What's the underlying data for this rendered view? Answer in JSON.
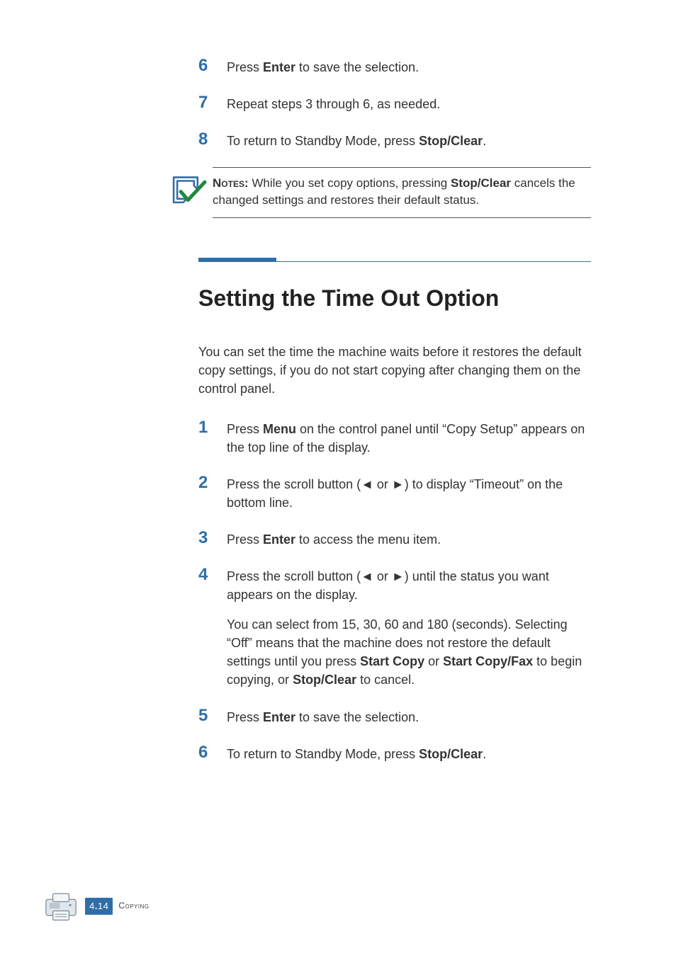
{
  "steps_top": [
    {
      "num": "6",
      "html": "Press <b>Enter</b> to save the selection."
    },
    {
      "num": "7",
      "html": "Repeat steps 3 through 6, as needed."
    },
    {
      "num": "8",
      "html": "To return to Standby Mode, press <b>Stop/Clear</b>."
    }
  ],
  "note": {
    "label": "Notes:",
    "text": " While you set copy options, pressing <b>Stop/Clear</b> cancels the changed settings and restores their default status."
  },
  "section": {
    "title": "Setting the Time Out Option",
    "intro": "You can set the time the machine waits before it restores the default copy settings, if you do not start copying after changing them on the control panel."
  },
  "steps_bottom": [
    {
      "num": "1",
      "html": "Press <b>Menu</b> on the control panel until “Copy Setup” appears on the top line of the display."
    },
    {
      "num": "2",
      "html": "Press the scroll button (◄ or ►) to display “Timeout” on the bottom line."
    },
    {
      "num": "3",
      "html": "Press <b>Enter</b> to access the menu item."
    },
    {
      "num": "4",
      "html": "Press the scroll button (◄ or ►) until the status you want appears on the display.",
      "extra": "You can select from 15, 30, 60 and 180 (seconds). Selecting “Off” means that the machine does not restore the default settings until you press <b>Start Copy</b> or <b>Start Copy/Fax</b> to begin copying, or <b>Stop/Clear</b> to cancel."
    },
    {
      "num": "5",
      "html": "Press <b>Enter</b> to save the selection."
    },
    {
      "num": "6",
      "html": "To return to Standby Mode, press <b>Stop/Clear</b>."
    }
  ],
  "footer": {
    "page_prefix": "4",
    "page_sep": ".",
    "page_num": "14",
    "chapter": "Copying"
  }
}
